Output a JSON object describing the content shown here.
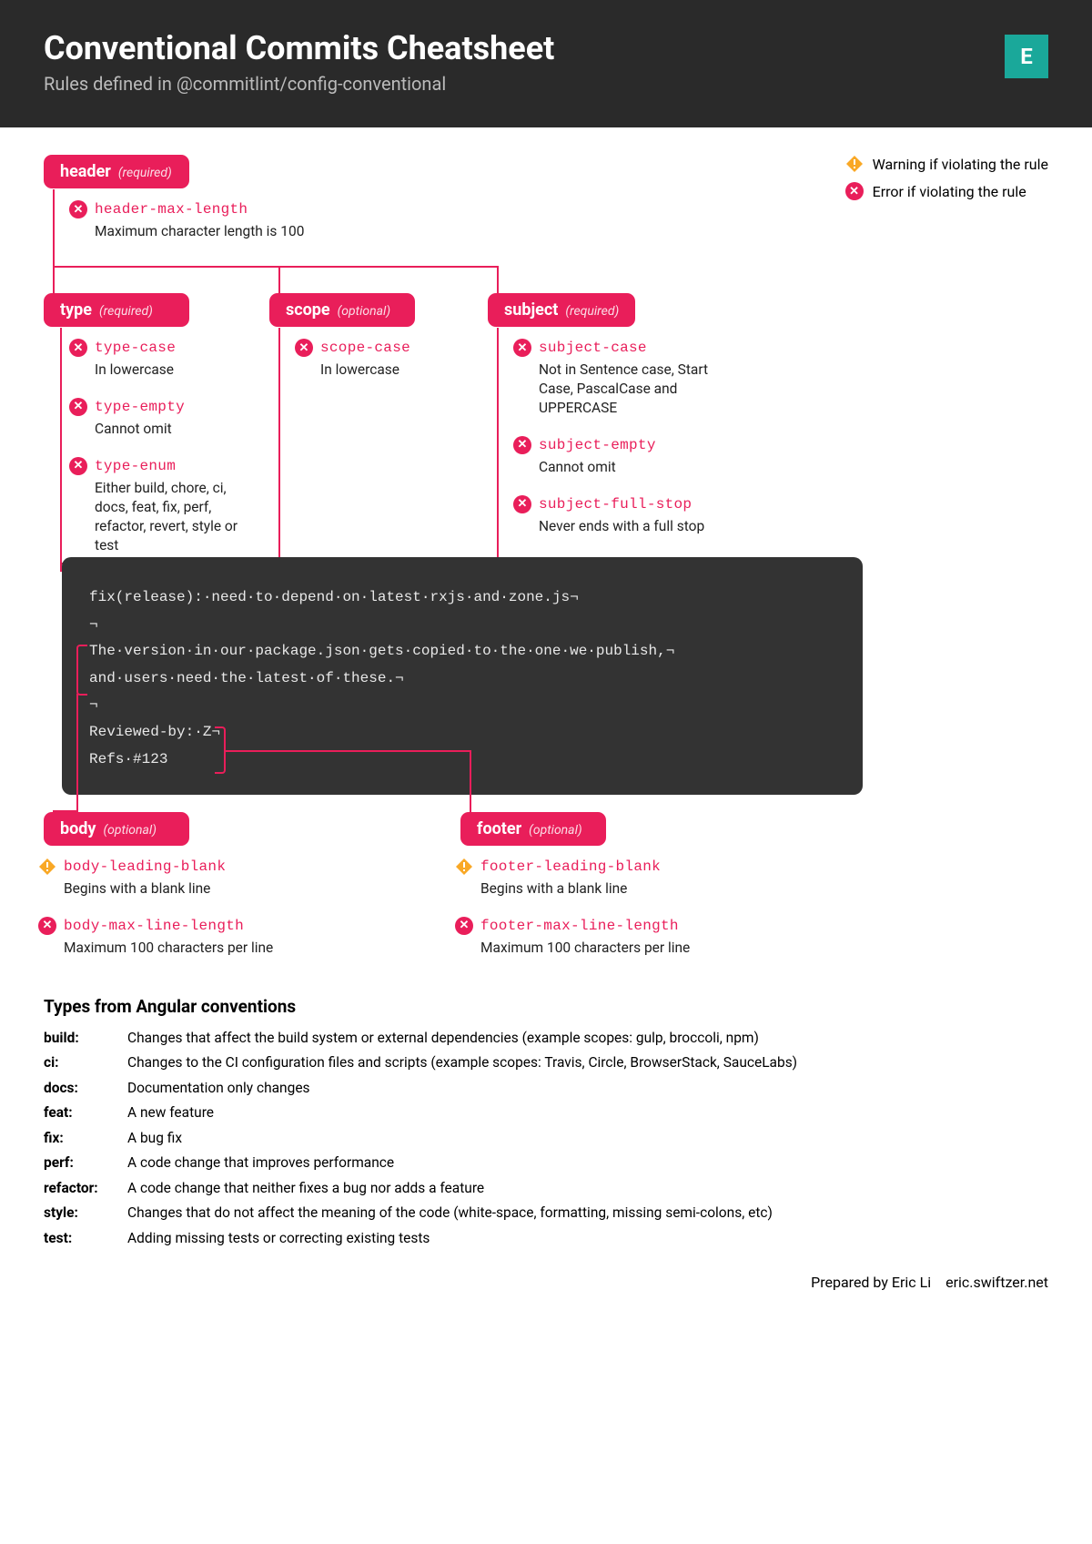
{
  "header": {
    "title": "Conventional Commits Cheatsheet",
    "subtitle": "Rules defined in @commitlint/config-conventional",
    "logo_text": "E"
  },
  "legend": {
    "warning": "Warning if violating the rule",
    "error": "Error if violating the rule"
  },
  "sections": {
    "header": {
      "title": "header",
      "tag": "(required)"
    },
    "type": {
      "title": "type",
      "tag": "(required)"
    },
    "scope": {
      "title": "scope",
      "tag": "(optional)"
    },
    "subject": {
      "title": "subject",
      "tag": "(required)"
    },
    "body": {
      "title": "body",
      "tag": "(optional)"
    },
    "footer": {
      "title": "footer",
      "tag": "(optional)"
    }
  },
  "rules": {
    "header_max_length": {
      "name": "header-max-length",
      "desc": "Maximum character length is 100",
      "level": "error"
    },
    "type_case": {
      "name": "type-case",
      "desc": "In lowercase",
      "level": "error"
    },
    "type_empty": {
      "name": "type-empty",
      "desc": "Cannot omit",
      "level": "error"
    },
    "type_enum": {
      "name": "type-enum",
      "desc": "Either build, chore, ci, docs, feat, fix, perf, refactor, revert, style or test",
      "level": "error"
    },
    "scope_case": {
      "name": "scope-case",
      "desc": "In lowercase",
      "level": "error"
    },
    "subject_case": {
      "name": "subject-case",
      "desc": "Not in Sentence case, Start Case, PascalCase and UPPERCASE",
      "level": "error"
    },
    "subject_empty": {
      "name": "subject-empty",
      "desc": "Cannot omit",
      "level": "error"
    },
    "subject_full_stop": {
      "name": "subject-full-stop",
      "desc": "Never ends with a full stop",
      "level": "error"
    },
    "body_leading_blank": {
      "name": "body-leading-blank",
      "desc": "Begins with a blank line",
      "level": "warning"
    },
    "body_max_line_length": {
      "name": "body-max-line-length",
      "desc": "Maximum 100 characters per line",
      "level": "error"
    },
    "footer_leading_blank": {
      "name": "footer-leading-blank",
      "desc": "Begins with a blank line",
      "level": "warning"
    },
    "footer_max_line_length": {
      "name": "footer-max-line-length",
      "desc": "Maximum 100 characters per line",
      "level": "error"
    }
  },
  "code": {
    "l1": "fix(release):·need·to·depend·on·latest·rxjs·and·zone.js¬",
    "l2": "¬",
    "l3": "The·version·in·our·package.json·gets·copied·to·the·one·we·publish,¬",
    "l4": "and·users·need·the·latest·of·these.¬",
    "l5": "¬",
    "l6": "Reviewed-by:·Z¬",
    "l7": "Refs·#123"
  },
  "angular": {
    "heading": "Types from Angular conventions",
    "items": [
      {
        "key": "build:",
        "val": "Changes that affect the build system or external dependencies (example scopes: gulp, broccoli, npm)"
      },
      {
        "key": "ci:",
        "val": "Changes to the CI configuration files and scripts (example scopes: Travis, Circle, BrowserStack, SauceLabs)"
      },
      {
        "key": "docs:",
        "val": "Documentation only changes"
      },
      {
        "key": "feat:",
        "val": "A new feature"
      },
      {
        "key": "fix:",
        "val": "A bug fix"
      },
      {
        "key": "perf:",
        "val": "A code change that improves performance"
      },
      {
        "key": "refactor:",
        "val": "A code change that neither fixes a bug nor adds a feature"
      },
      {
        "key": "style:",
        "val": "Changes that do not affect the meaning of the code (white-space, formatting, missing semi-colons, etc)"
      },
      {
        "key": "test:",
        "val": "Adding missing tests or correcting existing tests"
      }
    ]
  },
  "credit": {
    "author": "Prepared by Eric Li",
    "site": "eric.swiftzer.net"
  }
}
